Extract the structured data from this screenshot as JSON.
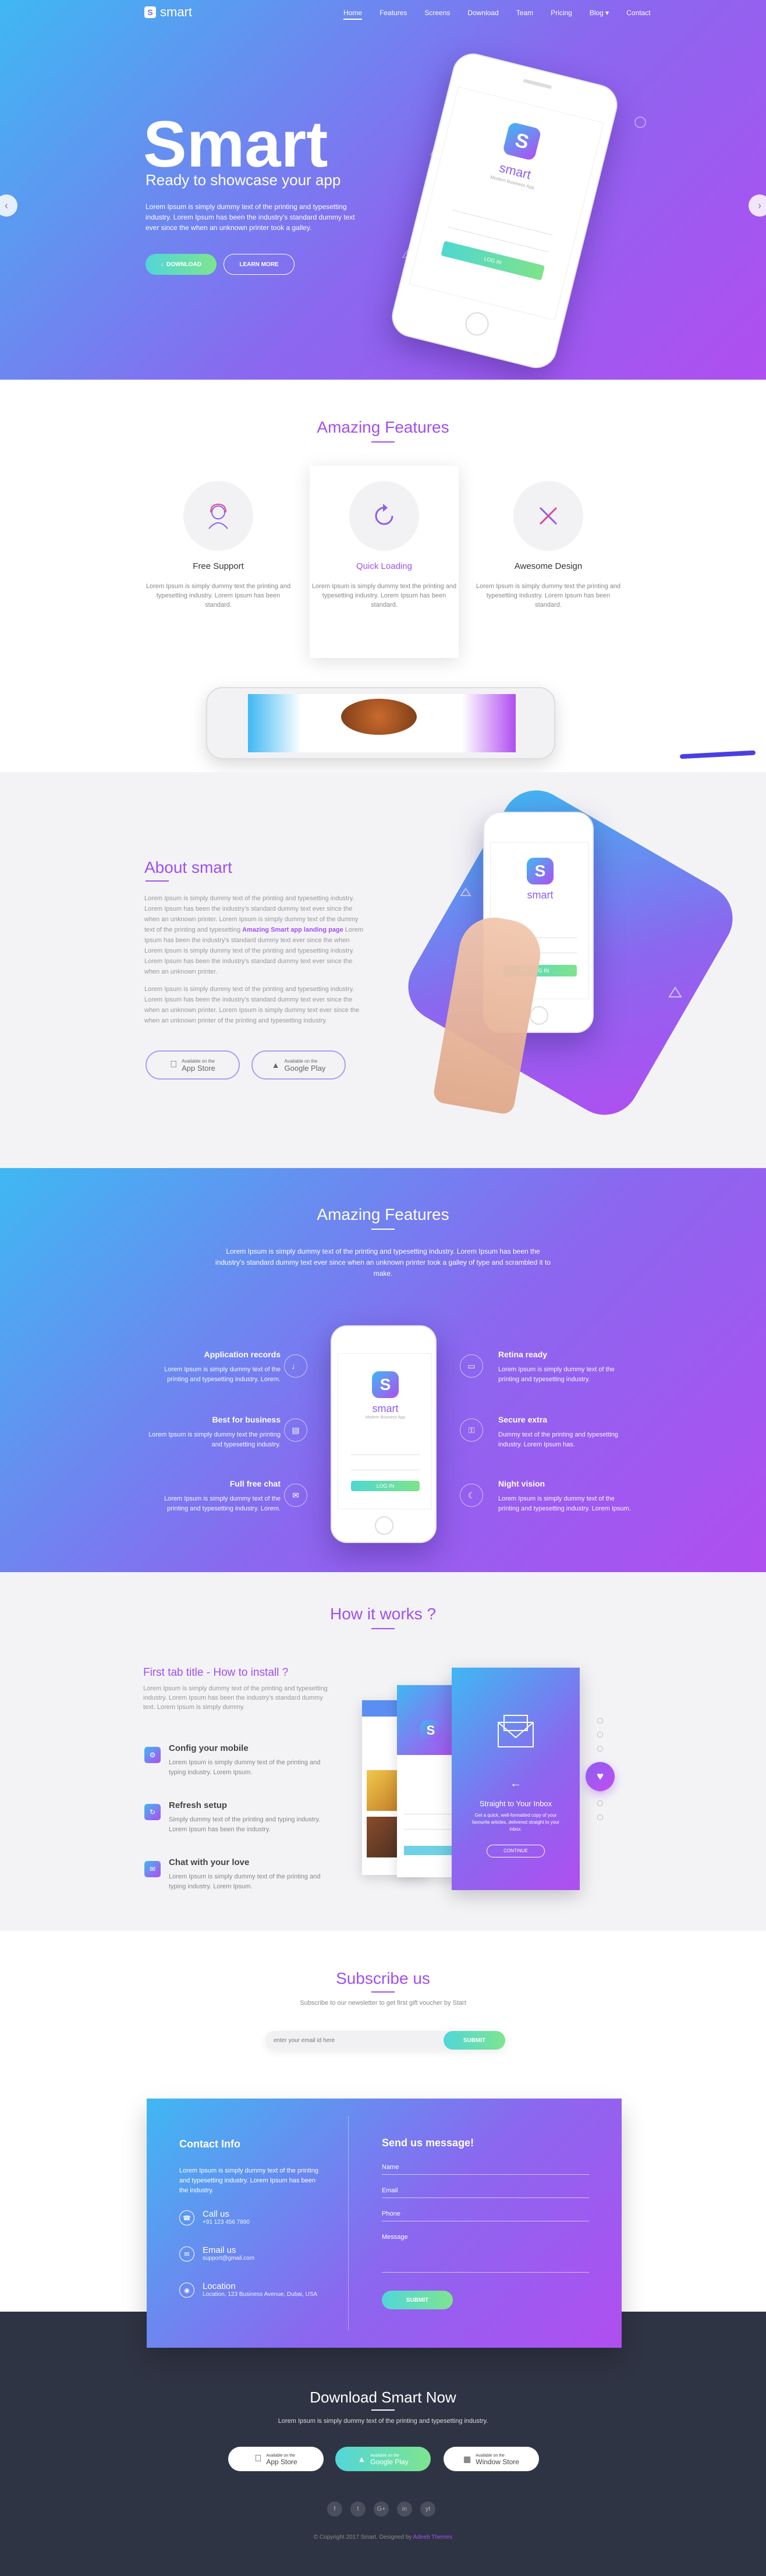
{
  "nav": {
    "logo_letter": "S",
    "logo_text": "smart",
    "items": [
      "Home",
      "Features",
      "Screens",
      "Download",
      "Team",
      "Pricing",
      "Blog ▾",
      "Contact"
    ]
  },
  "hero": {
    "title": "Smart",
    "subtitle": "Ready to showcase your app",
    "text": "Lorem Ipsum is simply dummy text of the printing and typesetting industry. Lorem Ipsum has been the industry's standard dummy text ever since the when an unknown printer took a galley.",
    "btn_download": "DOWNLOAD",
    "btn_learn": "LEARN MORE",
    "prev": "‹",
    "next": "›",
    "phone_app_name": "smart",
    "phone_tagline": "Modern Business App",
    "phone_login": "LOG IN"
  },
  "features": {
    "title": "Amazing Features",
    "items": [
      {
        "title": "Free Support",
        "text": "Lorem Ipsum is simply dummy text the printing and typesetting industry. Lorem Ipsum has been standard."
      },
      {
        "title": "Quick Loading",
        "text": "Lorem Ipsum is simply dummy text the printing and typesetting industry. Lorem Ipsum has been standard."
      },
      {
        "title": "Awesome Design",
        "text": "Lorem Ipsum is simply dummy text the printing and typesetting industry. Lorem Ipsum has been standard."
      }
    ]
  },
  "about": {
    "title": "About smart",
    "p1_a": "Lorem Ipsum is simply dummy text of the printing and typesetting industry. Lorem Ipsum has been the industry's standard dummy text ever since the when an unknown printer. Lorem Ipsum is simply dummy text of the dummy text of the printing and typesetting ",
    "p1_bold": "Amazing Smart app landing page",
    "p1_b": " Lorem Ipsum has been the industry's standard dummy text ever since the when Lorem Ipsum is simply dummy text of the printing and typesetting industry. Lorem Ipsum has been the industry's standard dummy text ever since the when an unknown printer.",
    "p2": "Lorem Ipsum is simply dummy text of the printing and typesetting industry. Lorem Ipsum has been the industry's standard dummy text ever since the when an unknown printer. Lorem Ipsum is simply dummy text ever since the when an unknown printer of the printing and typesetting industry.",
    "appstore_small": "Available on the",
    "appstore": "App Store",
    "gplay_small": "Available on the",
    "gplay": "Google Play"
  },
  "features2": {
    "title": "Amazing Features",
    "subtitle": "Lorem Ipsum is simply dummy text of the printing and typesetting industry. Lorem Ipsum has been the industry's standard dummy text ever since when an unknown printer took a galley of type and scrambled it to make.",
    "left": [
      {
        "title": "Application records",
        "text": "Lorem Ipsum is simply dummy text of the printing and typesetting industry. Lorem.",
        "icon": "♩"
      },
      {
        "title": "Best for business",
        "text": "Lorem Ipsum is simply dummy text the printing and typesetting industry.",
        "icon": "▤"
      },
      {
        "title": "Full free chat",
        "text": "Lorem Ipsum is simply dummy text of the printing and typesetting industry. Lorem.",
        "icon": "✉"
      }
    ],
    "right": [
      {
        "title": "Retina ready",
        "text": "Lorem Ipsum is simply dummy text of the printing and typesetting industry.",
        "icon": "▭"
      },
      {
        "title": "Secure extra",
        "text": "Dummy text of the printing and typesetting industry. Lorem Ipsum has.",
        "icon": "⚿"
      },
      {
        "title": "Night vision",
        "text": "Lorem Ipsum is simply dummy text of the printing and typesetting industry. Lorem Ipsum.",
        "icon": "☾"
      }
    ],
    "phone_app_name": "smart",
    "phone_tagline": "Modern Business App",
    "phone_login": "LOG IN"
  },
  "how": {
    "title": "How it works ?",
    "tab_title": "First tab title - How to install ?",
    "tab_text": "Lorem Ipsum is simply dummy text of the printing and typesetting industry. Lorem Ipsum has been the industry's standard dummy text. Lorem Ipsum is simply dummy.",
    "steps": [
      {
        "title": "Config your mobile",
        "text": "Lorem Ipsum is simply dummy text of the printing and typing industry. Lorem Ipsum."
      },
      {
        "title": "Refresh setup",
        "text": "Simply dummy text of the printing and typing industry. Lorem Ipsum has been the industry."
      },
      {
        "title": "Chat with your love",
        "text": "Lorem Ipsum is simply dummy text of the printing and typing industry. Lorem Ipsum."
      }
    ],
    "screen_title": "Straight to Your Inbox",
    "screen_text": "Get a quick, well-formatted copy of your favourite articles, delivered straight to your inbox.",
    "screen_btn": "CONTINUE"
  },
  "subscribe": {
    "title": "Subscribe us",
    "text": "Subscribe to our newsletter to get first gift voucher by Start",
    "placeholder": "enter your email id here",
    "button": "SUBMIT"
  },
  "contact": {
    "info_title": "Contact Info",
    "info_text": "Lorem Ipsum is simply dummy text of the printing and typesetting industry. Lorem Ipsum has been the industry.",
    "call_title": "Call us",
    "call_value": "+91 123 456 7890",
    "email_title": "Email us",
    "email_value": "support@gmail.com",
    "loc_title": "Location",
    "loc_value": "Location, 123 Business Avenue, Dubai, USA",
    "form_title": "Send us message!",
    "name": "Name",
    "email": "Email",
    "phone": "Phone",
    "message": "Message",
    "submit": "SUBMIT"
  },
  "footer": {
    "title": "Download Smart Now",
    "text": "Lorem Ipsum is simply dummy text of the printing and typesetting industry.",
    "app_small": "Available on the",
    "app": "App Store",
    "play_small": "Available on the",
    "play": "Google Play",
    "win_small": "Available on the",
    "win": "Window Store",
    "social": [
      "f",
      "t",
      "G+",
      "in",
      "yt"
    ],
    "copyright": "© Copyright 2017 Smart. Designed by",
    "author": "Adeeb Themes"
  }
}
